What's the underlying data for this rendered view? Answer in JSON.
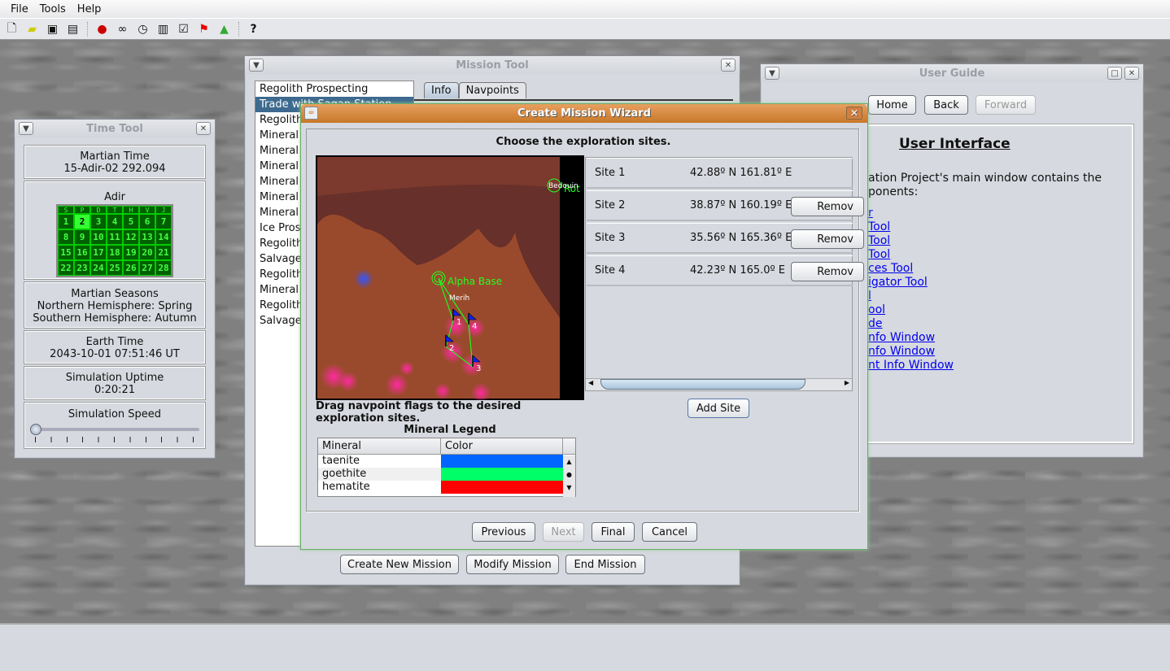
{
  "menu": [
    "File",
    "Tools",
    "Help"
  ],
  "toolbar_icons": [
    "new-file-icon",
    "open-folder-icon",
    "save-icon",
    "save-as-icon",
    "mars-globe-icon",
    "binoculars-icon",
    "clock-icon",
    "search-document-icon",
    "checklist-icon",
    "flag-icon",
    "flask-icon",
    "help-icon"
  ],
  "time_tool": {
    "title": "Time Tool",
    "martian_time_label": "Martian Time",
    "martian_time": "15-Adir-02  292.094",
    "month": "Adir",
    "weekdays": [
      "S",
      "P",
      "D",
      "T",
      "H",
      "V",
      "J"
    ],
    "days": [
      1,
      2,
      3,
      4,
      5,
      6,
      7,
      8,
      9,
      10,
      11,
      12,
      13,
      14,
      15,
      16,
      17,
      18,
      19,
      20,
      21,
      22,
      23,
      24,
      25,
      26,
      27,
      28
    ],
    "selected_day": 2,
    "seasons_label": "Martian Seasons",
    "northern": "Northern Hemisphere: Spring",
    "southern": "Southern Hemisphere: Autumn",
    "earth_time_label": "Earth Time",
    "earth_time": "2043-10-01  07:51:46 UT",
    "uptime_label": "Simulation Uptime",
    "uptime": "0:20:21",
    "speed_label": "Simulation Speed",
    "speed_value": 0
  },
  "mission_tool": {
    "title": "Mission Tool",
    "missions": [
      "Regolith Prospecting",
      "Trade with Sagan Station",
      "Regolith",
      "Mineral",
      "Mineral",
      "Mineral",
      "Mineral",
      "Mineral",
      "Mineral",
      "Ice Pros",
      "Regolith",
      "Salvage",
      "Regolith",
      "Mineral",
      "Regolith",
      "Salvage"
    ],
    "selected_index": 1,
    "tabs": [
      "Info",
      "Navpoints"
    ],
    "create": "Create New Mission",
    "modify": "Modify Mission",
    "end": "End Mission"
  },
  "user_guide": {
    "title": "User Guide",
    "home": "Home",
    "back": "Back",
    "forward": "Forward",
    "heading": "User Interface",
    "para1": "ation Project's main window contains the",
    "para2": "ponents:",
    "links": [
      "r",
      "Tool",
      "Tool",
      "Tool",
      "ces Tool",
      "igator Tool",
      "l",
      "ool",
      "de",
      "nfo Window",
      "nfo Window",
      "nt Info Window"
    ]
  },
  "wizard": {
    "title": "Create Mission Wizard",
    "prompt": "Choose the exploration sites.",
    "map": {
      "base": "Alpha Base",
      "settlement2": "Bedouin",
      "settlement2_partial": "Rot",
      "vehicle": "Merih",
      "flags": [
        "1",
        "2",
        "3",
        "4"
      ]
    },
    "instructions": "Drag navpoint flags to the desired exploration sites.",
    "sites": [
      {
        "name": "Site 1",
        "coords": "42.88º N 161.81º E",
        "remove": ""
      },
      {
        "name": "Site 2",
        "coords": "38.87º N 160.19º E",
        "remove": "Remov"
      },
      {
        "name": "Site 3",
        "coords": "35.56º N 165.36º E",
        "remove": "Remov"
      },
      {
        "name": "Site 4",
        "coords": "42.23º N 165.0º E",
        "remove": "Remov"
      }
    ],
    "add_site": "Add Site",
    "legend_title": "Mineral Legend",
    "legend_headers": [
      "Mineral",
      "Color"
    ],
    "legend": [
      {
        "mineral": "taenite",
        "color": "#0066ff"
      },
      {
        "mineral": "goethite",
        "color": "#00ff66"
      },
      {
        "mineral": "hematite",
        "color": "#ff0000"
      }
    ],
    "previous": "Previous",
    "next": "Next",
    "final": "Final",
    "cancel": "Cancel"
  }
}
